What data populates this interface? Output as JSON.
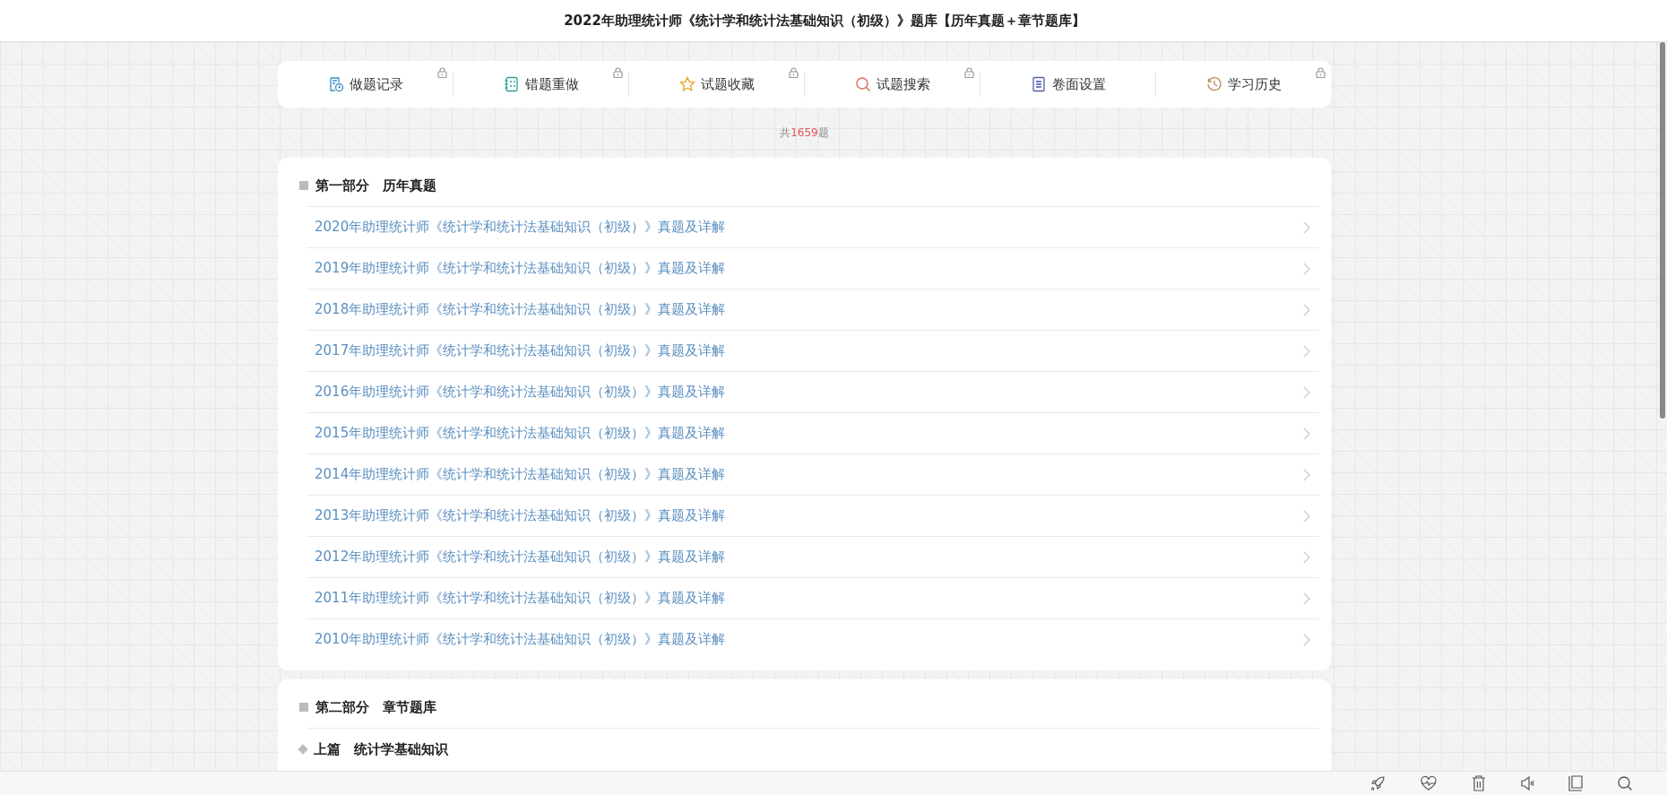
{
  "title": "2022年助理统计师《统计学和统计法基础知识（初级）》题库【历年真题＋章节题库】",
  "toolbar": [
    {
      "label": "做题记录",
      "locked": true
    },
    {
      "label": "错题重做",
      "locked": true
    },
    {
      "label": "试题收藏",
      "locked": true
    },
    {
      "label": "试题搜索",
      "locked": true
    },
    {
      "label": "卷面设置",
      "locked": false
    },
    {
      "label": "学习历史",
      "locked": true
    }
  ],
  "count": {
    "prefix": "共",
    "number": "1659",
    "suffix": "题"
  },
  "parts": [
    {
      "title": "第一部分　历年真题",
      "items": [
        {
          "label": "2020年助理统计师《统计学和统计法基础知识（初级）》真题及详解"
        },
        {
          "label": "2019年助理统计师《统计学和统计法基础知识（初级）》真题及详解"
        },
        {
          "label": "2018年助理统计师《统计学和统计法基础知识（初级）》真题及详解"
        },
        {
          "label": "2017年助理统计师《统计学和统计法基础知识（初级）》真题及详解"
        },
        {
          "label": "2016年助理统计师《统计学和统计法基础知识（初级）》真题及详解"
        },
        {
          "label": "2015年助理统计师《统计学和统计法基础知识（初级）》真题及详解"
        },
        {
          "label": "2014年助理统计师《统计学和统计法基础知识（初级）》真题及详解"
        },
        {
          "label": "2013年助理统计师《统计学和统计法基础知识（初级）》真题及详解"
        },
        {
          "label": "2012年助理统计师《统计学和统计法基础知识（初级）》真题及详解"
        },
        {
          "label": "2011年助理统计师《统计学和统计法基础知识（初级）》真题及详解"
        },
        {
          "label": "2010年助理统计师《统计学和统计法基础知识（初级）》真题及详解"
        }
      ]
    },
    {
      "title": "第二部分　章节题库",
      "subsections": [
        {
          "title": "上篇　统计学基础知识"
        }
      ]
    }
  ]
}
